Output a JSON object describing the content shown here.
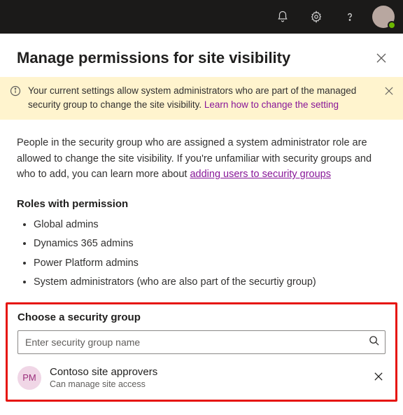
{
  "header": {
    "title": "Manage permissions for site visibility"
  },
  "banner": {
    "text_a": "Your current settings allow system administrators who are part of the managed security group to change the site visibility. ",
    "link": "Learn how to change the setting"
  },
  "intro": {
    "text_a": "People in the security group who are assigned a system administrator role are allowed to change the site visibility. If you're unfamiliar with security groups and who to add, you can learn more about ",
    "link": "adding users to security groups"
  },
  "roles": {
    "heading": "Roles with permission",
    "items": [
      "Global admins",
      "Dynamics 365 admins",
      "Power Platform admins",
      "System administrators (who are also part of the securtiy group)"
    ]
  },
  "picker": {
    "heading": "Choose a security group",
    "placeholder": "Enter security group name",
    "selected": {
      "initials": "PM",
      "name": "Contoso site approvers",
      "sub": "Can manage site access"
    }
  }
}
